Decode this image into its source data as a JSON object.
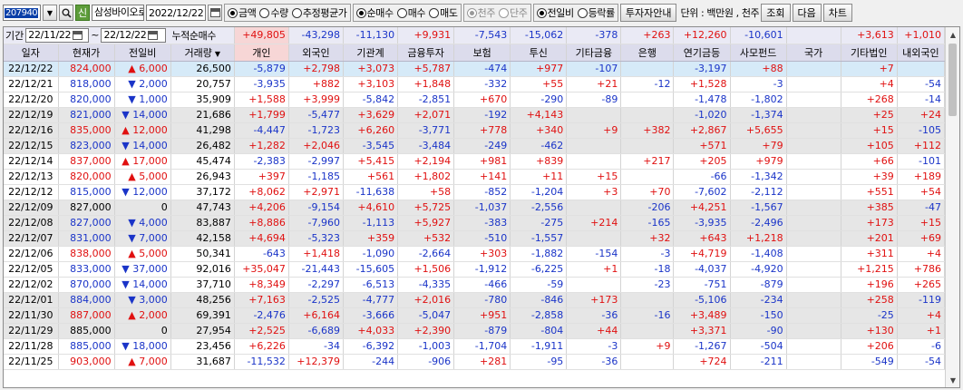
{
  "toolbar": {
    "code": "207940",
    "search_icon": "search-icon",
    "sin_label": "신",
    "stock_name": "삼성바이오로직스",
    "date": "2022/12/22",
    "value_modes": [
      "금액",
      "수량",
      "추정평균가"
    ],
    "value_mode_selected": 0,
    "trade_modes": [
      "순매수",
      "매수",
      "매도"
    ],
    "trade_mode_selected": 0,
    "unit_modes": [
      "천주",
      "단주"
    ],
    "unit_mode_selected": 0,
    "compare_modes": [
      "전일비",
      "등락률"
    ],
    "compare_mode_selected": 0,
    "guide_label": "투자자안내",
    "unit_text": "단위 : 백만원 , 천주",
    "query_label": "조회",
    "next_label": "다음",
    "chart_label": "차트"
  },
  "period": {
    "label": "기간",
    "from": "22/11/22",
    "to": "22/12/22",
    "sum_label": "누적순매수"
  },
  "sum_row": [
    "+49,805",
    "-43,298",
    "-11,130",
    "+9,931",
    "-7,543",
    "-15,062",
    "-378",
    "+263",
    "+12,260",
    "-10,601",
    "",
    "+3,613",
    "+1,010"
  ],
  "columns": [
    "일자",
    "현재가",
    "전일비",
    "거래량",
    "개인",
    "외국인",
    "기관계",
    "금융투자",
    "보험",
    "투신",
    "기타금융",
    "은행",
    "연기금등",
    "사모펀드",
    "국가",
    "기타법인",
    "내외국인"
  ],
  "rows": [
    {
      "date": "22/12/22",
      "price": "824,000",
      "dir": "up",
      "chg": "6,000",
      "vol": "26,500",
      "v": [
        "-5,879",
        "+2,798",
        "+3,073",
        "+5,787",
        "-474",
        "+977",
        "-107",
        "",
        "-3,197",
        "+88",
        "",
        "+7",
        ""
      ]
    },
    {
      "date": "22/12/21",
      "price": "818,000",
      "dir": "dn",
      "chg": "2,000",
      "vol": "20,757",
      "v": [
        "-3,935",
        "+882",
        "+3,103",
        "+1,848",
        "-332",
        "+55",
        "+21",
        "-12",
        "+1,528",
        "-3",
        "",
        "+4",
        "-54"
      ]
    },
    {
      "date": "22/12/20",
      "price": "820,000",
      "dir": "dn",
      "chg": "1,000",
      "vol": "35,909",
      "v": [
        "+1,588",
        "+3,999",
        "-5,842",
        "-2,851",
        "+670",
        "-290",
        "-89",
        "",
        "-1,478",
        "-1,802",
        "",
        "+268",
        "-14"
      ]
    },
    {
      "date": "22/12/19",
      "price": "821,000",
      "dir": "dn",
      "chg": "14,000",
      "vol": "21,686",
      "v": [
        "+1,799",
        "-5,477",
        "+3,629",
        "+2,071",
        "-192",
        "+4,143",
        "",
        "",
        "-1,020",
        "-1,374",
        "",
        "+25",
        "+24"
      ]
    },
    {
      "date": "22/12/16",
      "price": "835,000",
      "dir": "up",
      "chg": "12,000",
      "vol": "41,298",
      "v": [
        "-4,447",
        "-1,723",
        "+6,260",
        "-3,771",
        "+778",
        "+340",
        "+9",
        "+382",
        "+2,867",
        "+5,655",
        "",
        "+15",
        "-105"
      ]
    },
    {
      "date": "22/12/15",
      "price": "823,000",
      "dir": "dn",
      "chg": "14,000",
      "vol": "26,482",
      "v": [
        "+1,282",
        "+2,046",
        "-3,545",
        "-3,484",
        "-249",
        "-462",
        "",
        "",
        "+571",
        "+79",
        "",
        "+105",
        "+112"
      ]
    },
    {
      "date": "22/12/14",
      "price": "837,000",
      "dir": "up",
      "chg": "17,000",
      "vol": "45,474",
      "v": [
        "-2,383",
        "-2,997",
        "+5,415",
        "+2,194",
        "+981",
        "+839",
        "",
        "+217",
        "+205",
        "+979",
        "",
        "+66",
        "-101"
      ]
    },
    {
      "date": "22/12/13",
      "price": "820,000",
      "dir": "up",
      "chg": "5,000",
      "vol": "26,943",
      "v": [
        "+397",
        "-1,185",
        "+561",
        "+1,802",
        "+141",
        "+11",
        "+15",
        "",
        "-66",
        "-1,342",
        "",
        "+39",
        "+189"
      ]
    },
    {
      "date": "22/12/12",
      "price": "815,000",
      "dir": "dn",
      "chg": "12,000",
      "vol": "37,172",
      "v": [
        "+8,062",
        "+2,971",
        "-11,638",
        "+58",
        "-852",
        "-1,204",
        "+3",
        "+70",
        "-7,602",
        "-2,112",
        "",
        "+551",
        "+54"
      ]
    },
    {
      "date": "22/12/09",
      "price": "827,000",
      "dir": "nu",
      "chg": "0",
      "vol": "47,743",
      "v": [
        "+4,206",
        "-9,154",
        "+4,610",
        "+5,725",
        "-1,037",
        "-2,556",
        "",
        "-206",
        "+4,251",
        "-1,567",
        "",
        "+385",
        "-47"
      ]
    },
    {
      "date": "22/12/08",
      "price": "827,000",
      "dir": "dn",
      "chg": "4,000",
      "vol": "83,887",
      "v": [
        "+8,886",
        "-7,960",
        "-1,113",
        "+5,927",
        "-383",
        "-275",
        "+214",
        "-165",
        "-3,935",
        "-2,496",
        "",
        "+173",
        "+15"
      ]
    },
    {
      "date": "22/12/07",
      "price": "831,000",
      "dir": "dn",
      "chg": "7,000",
      "vol": "42,158",
      "v": [
        "+4,694",
        "-5,323",
        "+359",
        "+532",
        "-510",
        "-1,557",
        "",
        "+32",
        "+643",
        "+1,218",
        "",
        "+201",
        "+69"
      ]
    },
    {
      "date": "22/12/06",
      "price": "838,000",
      "dir": "up",
      "chg": "5,000",
      "vol": "50,341",
      "v": [
        "-643",
        "+1,418",
        "-1,090",
        "-2,664",
        "+303",
        "-1,882",
        "-154",
        "-3",
        "+4,719",
        "-1,408",
        "",
        "+311",
        "+4"
      ]
    },
    {
      "date": "22/12/05",
      "price": "833,000",
      "dir": "dn",
      "chg": "37,000",
      "vol": "92,016",
      "v": [
        "+35,047",
        "-21,443",
        "-15,605",
        "+1,506",
        "-1,912",
        "-6,225",
        "+1",
        "-18",
        "-4,037",
        "-4,920",
        "",
        "+1,215",
        "+786"
      ]
    },
    {
      "date": "22/12/02",
      "price": "870,000",
      "dir": "dn",
      "chg": "14,000",
      "vol": "37,710",
      "v": [
        "+8,349",
        "-2,297",
        "-6,513",
        "-4,335",
        "-466",
        "-59",
        "",
        "-23",
        "-751",
        "-879",
        "",
        "+196",
        "+265"
      ]
    },
    {
      "date": "22/12/01",
      "price": "884,000",
      "dir": "dn",
      "chg": "3,000",
      "vol": "48,256",
      "v": [
        "+7,163",
        "-2,525",
        "-4,777",
        "+2,016",
        "-780",
        "-846",
        "+173",
        "",
        "-5,106",
        "-234",
        "",
        "+258",
        "-119"
      ]
    },
    {
      "date": "22/11/30",
      "price": "887,000",
      "dir": "up",
      "chg": "2,000",
      "vol": "69,391",
      "v": [
        "-2,476",
        "+6,164",
        "-3,666",
        "-5,047",
        "+951",
        "-2,858",
        "-36",
        "-16",
        "+3,489",
        "-150",
        "",
        "-25",
        "+4"
      ]
    },
    {
      "date": "22/11/29",
      "price": "885,000",
      "dir": "nu",
      "chg": "0",
      "vol": "27,954",
      "v": [
        "+2,525",
        "-6,689",
        "+4,033",
        "+2,390",
        "-879",
        "-804",
        "+44",
        "",
        "+3,371",
        "-90",
        "",
        "+130",
        "+1"
      ]
    },
    {
      "date": "22/11/28",
      "price": "885,000",
      "dir": "dn",
      "chg": "18,000",
      "vol": "23,456",
      "v": [
        "+6,226",
        "-34",
        "-6,392",
        "-1,003",
        "-1,704",
        "-1,911",
        "-3",
        "+9",
        "-1,267",
        "-504",
        "",
        "+206",
        "-6"
      ]
    },
    {
      "date": "22/11/25",
      "price": "903,000",
      "dir": "up",
      "chg": "7,000",
      "vol": "31,687",
      "v": [
        "-11,532",
        "+12,379",
        "-244",
        "-906",
        "+281",
        "-95",
        "-36",
        "",
        "+724",
        "-211",
        "",
        "-549",
        "-54"
      ]
    }
  ],
  "colors": {
    "up": "#e01010",
    "down": "#1a34c8",
    "selected": "#d6eaf8",
    "header": "#dcdcec",
    "pink_header": "#f7d6d6"
  }
}
